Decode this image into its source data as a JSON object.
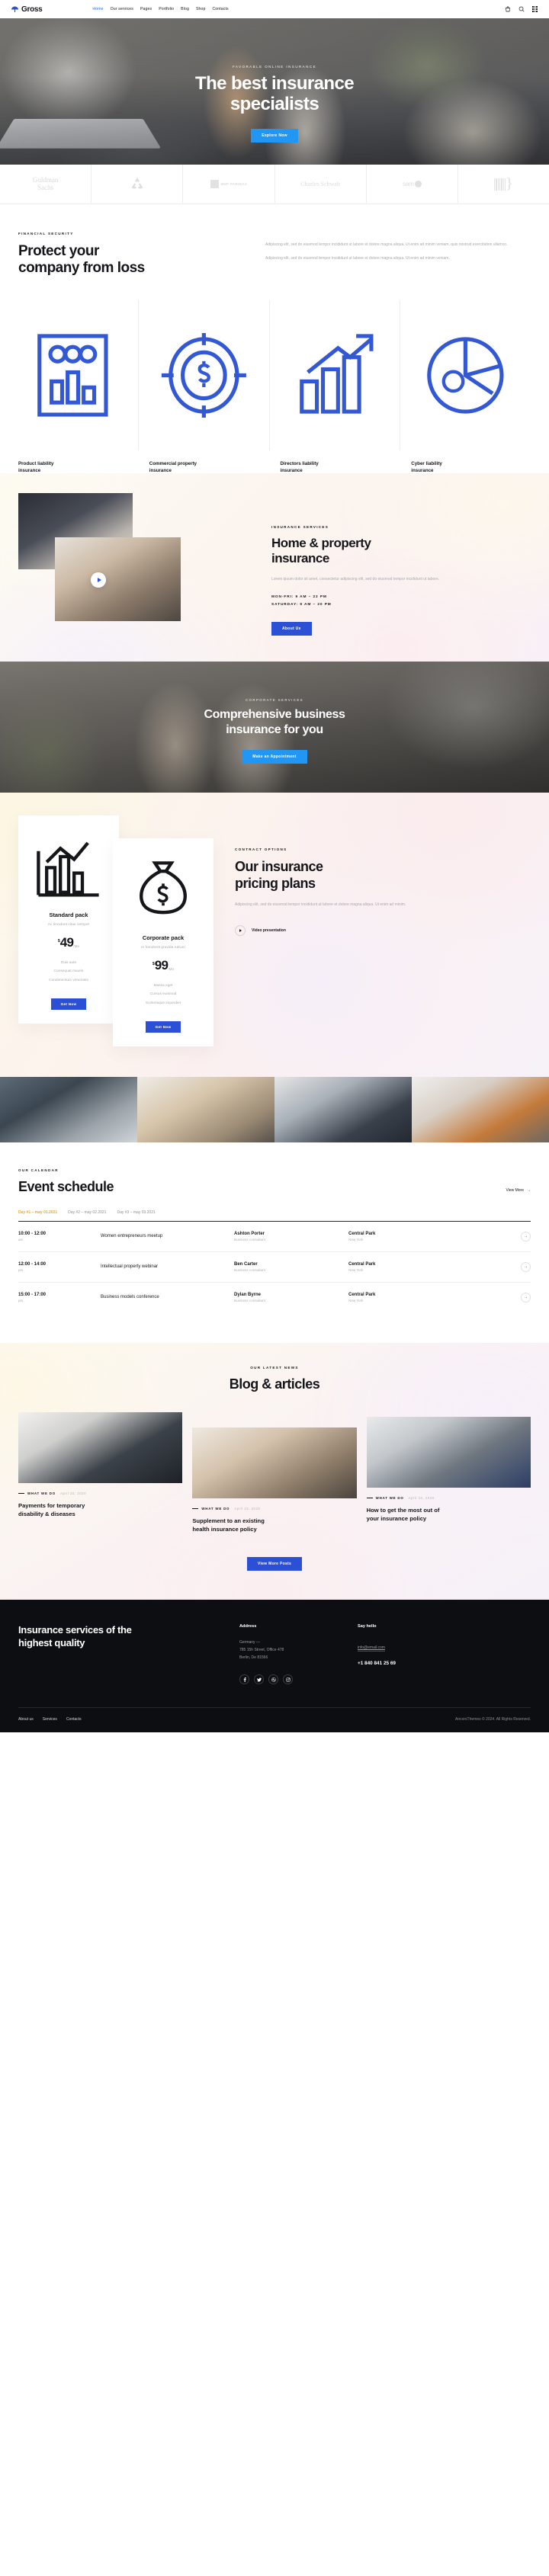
{
  "header": {
    "brand": "Gross",
    "brand_icon": "umbrella-icon",
    "nav": [
      {
        "label": "Home",
        "active": true
      },
      {
        "label": "Our services",
        "active": false
      },
      {
        "label": "Pages",
        "active": false
      },
      {
        "label": "Portfolio",
        "active": false
      },
      {
        "label": "Blog",
        "active": false
      },
      {
        "label": "Shop",
        "active": false
      },
      {
        "label": "Contacts",
        "active": false
      }
    ],
    "icons": [
      "cart-icon",
      "search-icon",
      "menu-grid-icon"
    ],
    "accent_color": "#2f6bf0"
  },
  "hero": {
    "eyebrow": "FAVORABLE ONLINE INSURANCE",
    "title_line1": "The best insurance",
    "title_line2": "specialists",
    "cta": "Explore Now"
  },
  "logos": [
    {
      "name": "Goldman Sachs",
      "line1": "Goldman",
      "line2": "Sachs"
    },
    {
      "name": "recycle-logo",
      "line1": "",
      "line2": ""
    },
    {
      "name": "BNP PARIBAS",
      "line1": "BNP PARIBAS",
      "line2": ""
    },
    {
      "name": "Charles Schwab",
      "line1": "Charles Schwab",
      "line2": ""
    },
    {
      "name": "sam",
      "line1": "sam",
      "line2": ""
    },
    {
      "name": "bars-logo",
      "line1": "",
      "line2": ""
    }
  ],
  "protect": {
    "eyebrow": "FINANCIAL SECURITY",
    "title_line1": "Protect your",
    "title_line2": "company from loss",
    "paragraph1": "Adipiscing elit, sed do eiusmod tempor incididunt ut labore et dolore magna aliqua. Ut enim ad minim veniam, quis nostrud exercitation ullamco.",
    "paragraph2": "Adipiscing elit, sed do eiusmod tempor incididunt ut labore et dolore magna aliqua. Ut enim ad minim veniam.",
    "cards": [
      {
        "icon": "product-liability-icon",
        "title_line1": "Product liability",
        "title_line2": "insurance",
        "arrow": "→"
      },
      {
        "icon": "commercial-property-icon",
        "title_line1": "Commercial property",
        "title_line2": "insurance",
        "arrow": "→"
      },
      {
        "icon": "directors-liability-icon",
        "title_line1": "Directors liability",
        "title_line2": "insurance",
        "arrow": "→"
      },
      {
        "icon": "cyber-liability-icon",
        "title_line1": "Cyber liability",
        "title_line2": "insurance",
        "arrow": "→"
      }
    ]
  },
  "home_property": {
    "eyebrow": "INSURANCE SERVICES",
    "title_line1": "Home & property",
    "title_line2": "insurance",
    "paragraph": "Lorem ipsum dolor sit amet, consectetur adipiscing elit, sed do eiusmod tempor incididunt ut labore.",
    "hours_weekday": "MON-FRI: 9 AM – 22 PM",
    "hours_saturday": "SATURDAY: 9 AM – 20 PM",
    "cta": "About Us",
    "play_icon": "play-button-icon"
  },
  "banner": {
    "eyebrow": "CORPORATE SERVICES",
    "title_line1": "Comprehensive business",
    "title_line2": "insurance for you",
    "cta": "Make an Appointment"
  },
  "pricing": {
    "eyebrow": "CONTRACT OPTIONS",
    "title_line1": "Our insurance",
    "title_line2": "pricing plans",
    "paragraph": "Adipiscing elit, sed do eiusmod tempor incididunt ut labore et dolore magna aliqua. Ut enim ad minim.",
    "video_label": "Video presentation",
    "plans": [
      {
        "icon": "chart-bars-icon",
        "name": "Standard pack",
        "subtitle": "Ac tincidunt vitae semper",
        "currency": "$",
        "amount": "49",
        "period": "/Mo",
        "features": [
          "Duis aute",
          "Consequat mauris",
          "Condimentum venenatis"
        ],
        "cta": "Get Now"
      },
      {
        "icon": "money-bag-icon",
        "name": "Corporate pack",
        "subtitle": "In hendrerit gravida rutrum",
        "currency": "$",
        "amount": "99",
        "period": "/Mo",
        "features": [
          "Massa eget",
          "Cursus euismod",
          "Scelerisque imperdiet"
        ],
        "cta": "Get Now"
      }
    ]
  },
  "events": {
    "eyebrow": "OUR CALENDAR",
    "title": "Event schedule",
    "view_more": "View More",
    "view_more_arrow": "→",
    "days": [
      {
        "label": "Day #1 – may 01.2021",
        "active": true
      },
      {
        "label": "Day #2 – may 02.2021",
        "active": false
      },
      {
        "label": "Day #3 – may 03.2021",
        "active": false
      }
    ],
    "rows": [
      {
        "time": "10:00 - 12:00",
        "meridiem": "am",
        "name": "Women entrepreneurs meetup",
        "person": "Ashton Porter",
        "person_role": "Business consultant",
        "place": "Central Park",
        "place_city": "New York",
        "arrow": "→"
      },
      {
        "time": "12:00 - 14:00",
        "meridiem": "pm",
        "name": "Intellectual property webinar",
        "person": "Ben Carter",
        "person_role": "Business consultant",
        "place": "Central Park",
        "place_city": "New York",
        "arrow": "→"
      },
      {
        "time": "15:00 - 17:00",
        "meridiem": "pm",
        "name": "Business models conference",
        "person": "Dylan Byrne",
        "person_role": "Business consultant",
        "place": "Central Park",
        "place_city": "New York",
        "arrow": "→"
      }
    ]
  },
  "blog": {
    "eyebrow": "OUR LATEST NEWS",
    "title": "Blog & articles",
    "cta": "View More Posts",
    "posts": [
      {
        "category": "WHAT WE DO",
        "date": "April 20, 2020",
        "title_line1": "Payments for temporary",
        "title_line2": "disability & diseases"
      },
      {
        "category": "WHAT WE DO",
        "date": "April 15, 2020",
        "title_line1": "Supplement to an existing",
        "title_line2": "health insurance policy"
      },
      {
        "category": "WHAT WE DO",
        "date": "April 10, 2020",
        "title_line1": "How to get the most out of",
        "title_line2": "your insurance policy"
      }
    ]
  },
  "footer": {
    "title_line1": "Insurance services of the",
    "title_line2": "highest quality",
    "address_heading": "Address",
    "address_line1": "Germany —",
    "address_line2": "785 15h Street, Office 478",
    "address_line3": "Berlin, De 81566",
    "contact_heading": "Say hello",
    "email": "info@email.com",
    "phone": "+1 840 841 25 69",
    "social": [
      "facebook-icon",
      "twitter-icon",
      "dribbble-icon",
      "instagram-icon"
    ],
    "links": [
      "About us",
      "Services",
      "Contacts"
    ],
    "copyright": "AncorsThemes © 2024. All Rights Reserved."
  }
}
